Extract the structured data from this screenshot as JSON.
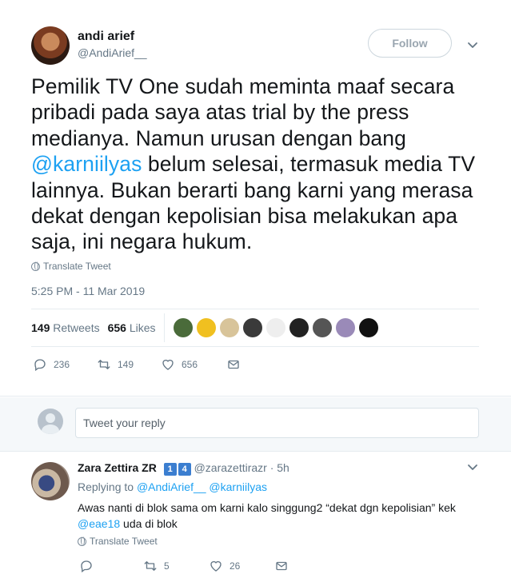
{
  "tweet": {
    "author_name": "andi arief",
    "author_handle": "@AndiArief__",
    "follow_label": "Follow",
    "text_before_mention": "Pemilik TV One sudah meminta maaf secara pribadi pada saya atas trial by the press medianya. Namun urusan dengan bang ",
    "mention": "@karniilyas",
    "text_after_mention": " belum selesai, termasuk media TV lainnya. Bukan berarti bang karni yang merasa dekat dengan kepolisian bisa melakukan apa saja, ini negara hukum.",
    "translate_label": "Translate Tweet",
    "timestamp": "5:25 PM - 11 Mar 2019",
    "retweets_count": "149",
    "retweets_label": "Retweets",
    "likes_count": "656",
    "likes_label": "Likes",
    "liker_colors": [
      "#4a6b3a",
      "#f0c020",
      "#d8c49a",
      "#3a3a3a",
      "#eeeeee",
      "#222222",
      "#555555",
      "#9a8ab8",
      "#111111"
    ],
    "replies_count": "236",
    "retweet_action_count": "149",
    "like_action_count": "656"
  },
  "reply_box": {
    "placeholder": "Tweet your reply"
  },
  "reply": {
    "author_name": "Zara Zettira ZR",
    "badges": [
      "1",
      "4"
    ],
    "author_handle": "@zarazettirazr",
    "time": "· 5h",
    "replying_to_label": "Replying to",
    "replying_to_1": "@AndiArief__",
    "replying_to_2": "@karniilyas",
    "text_line1": "Awas nanti di blok sama om karni kalo singgung2 “dekat dgn kepolisian” kek",
    "mention": "@eae18",
    "text_line2": " uda di blok",
    "translate_label": "Translate Tweet",
    "retweet_count": "5",
    "like_count": "26"
  }
}
